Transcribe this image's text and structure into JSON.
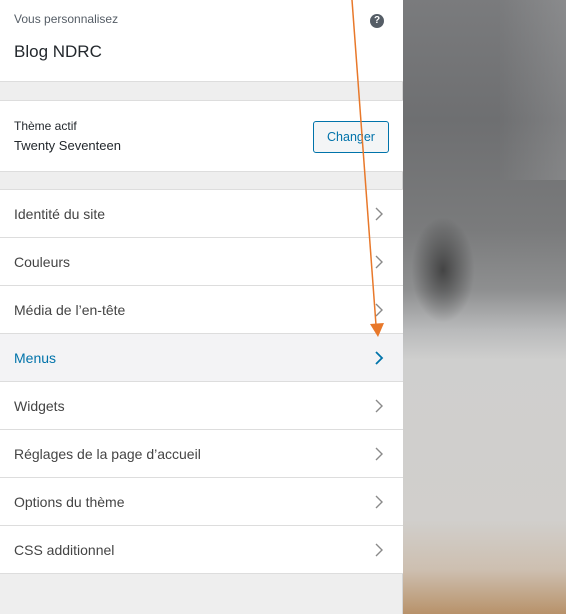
{
  "header": {
    "subtitle": "Vous personnalisez",
    "site_title": "Blog NDRC",
    "help_glyph": "?"
  },
  "theme": {
    "label": "Thème actif",
    "name": "Twenty Seventeen",
    "change_label": "Changer"
  },
  "sections": [
    {
      "label": "Identité du site",
      "active": false
    },
    {
      "label": "Couleurs",
      "active": false
    },
    {
      "label": "Média de l’en-tête",
      "active": false
    },
    {
      "label": "Menus",
      "active": true
    },
    {
      "label": "Widgets",
      "active": false
    },
    {
      "label": "Réglages de la page d’accueil",
      "active": false
    },
    {
      "label": "Options du thème",
      "active": false
    },
    {
      "label": "CSS additionnel",
      "active": false
    }
  ],
  "colors": {
    "accent": "#0073aa",
    "annotation_arrow": "#e8782a"
  },
  "icons": {
    "help": "help-icon",
    "chevron": "chevron-right-icon"
  }
}
